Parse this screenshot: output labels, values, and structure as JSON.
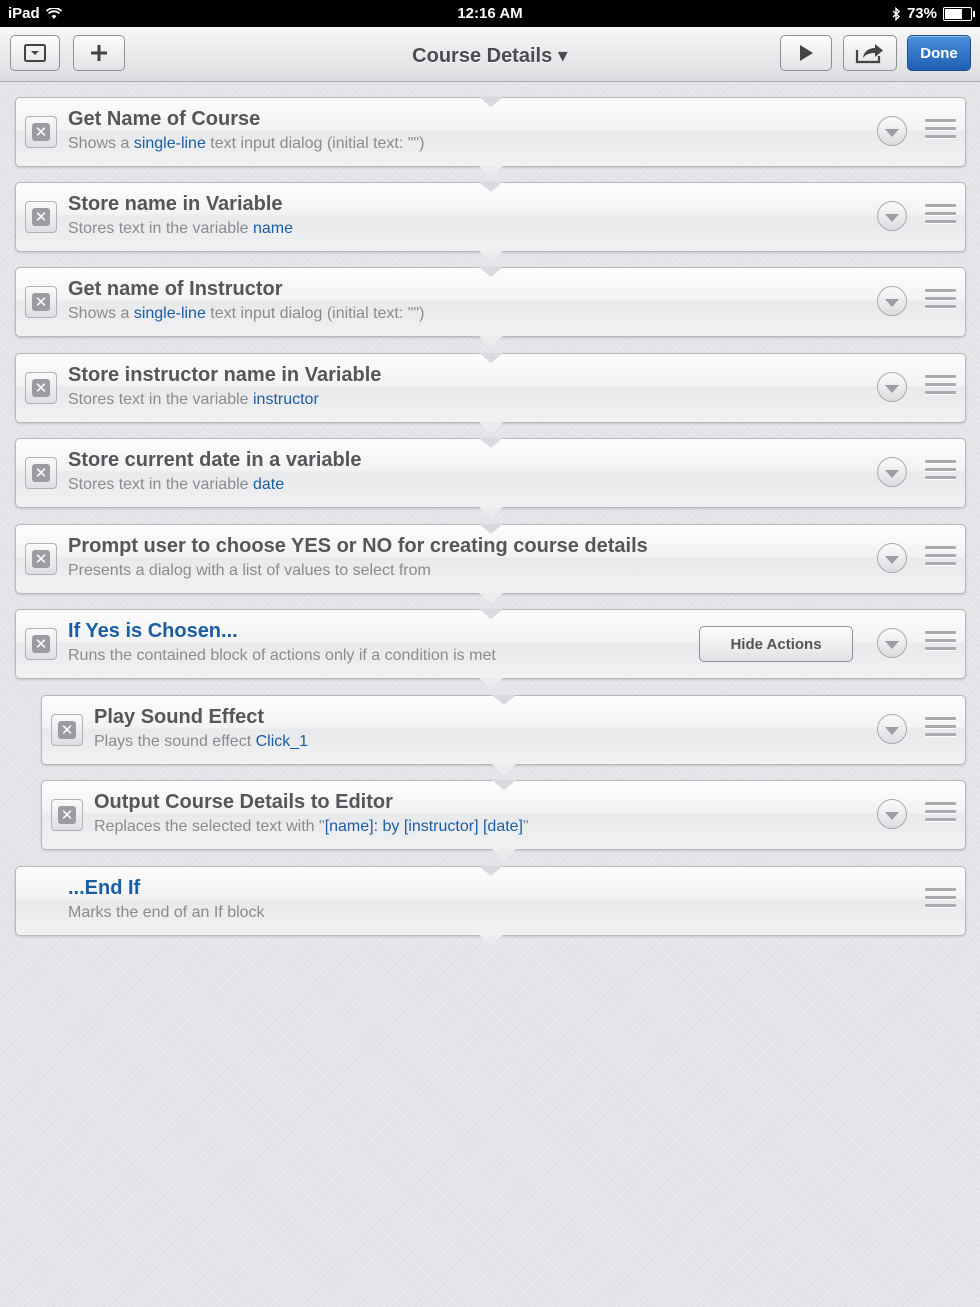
{
  "status": {
    "device": "iPad",
    "time": "12:16 AM",
    "battery": "73%",
    "battery_level": 0.73
  },
  "toolbar": {
    "title": "Course Details",
    "title_caret": "▾",
    "done_label": "Done"
  },
  "actions": [
    {
      "title": "Get Name of Course",
      "sub_pre": "Shows a ",
      "sub_link": "single-line",
      "sub_post": " text input dialog (initial text: \"\")"
    },
    {
      "title": "Store name in Variable",
      "sub_pre": "Stores text in the variable ",
      "sub_link": "name",
      "sub_post": ""
    },
    {
      "title": "Get name of Instructor",
      "sub_pre": "Shows a ",
      "sub_link": "single-line",
      "sub_post": " text input dialog (initial text: \"\")"
    },
    {
      "title": "Store instructor name in Variable",
      "sub_pre": "Stores text in the variable ",
      "sub_link": "instructor",
      "sub_post": ""
    },
    {
      "title": "Store current date in a variable",
      "sub_pre": "Stores text in the variable ",
      "sub_link": "date",
      "sub_post": ""
    },
    {
      "title": "Prompt user to choose YES or NO for creating course details",
      "sub_pre": "Presents a dialog with a list of values to select from",
      "sub_link": "",
      "sub_post": ""
    },
    {
      "title": "If Yes is Chosen...",
      "sub_pre": "Runs the contained block of actions only if a condition is met",
      "sub_link": "",
      "sub_post": "",
      "button": "Hide Actions"
    },
    {
      "title": "Play Sound Effect",
      "sub_pre": "Plays the sound effect ",
      "sub_link": "Click_1",
      "sub_post": ""
    },
    {
      "title": "Output Course Details to Editor",
      "sub_pre": "Replaces the selected text with \"",
      "sub_link": "[name]: by [instructor] [date]",
      "sub_post": "\""
    },
    {
      "title": "...End If",
      "sub_pre": "Marks the end of an If block",
      "sub_link": "",
      "sub_post": ""
    }
  ]
}
